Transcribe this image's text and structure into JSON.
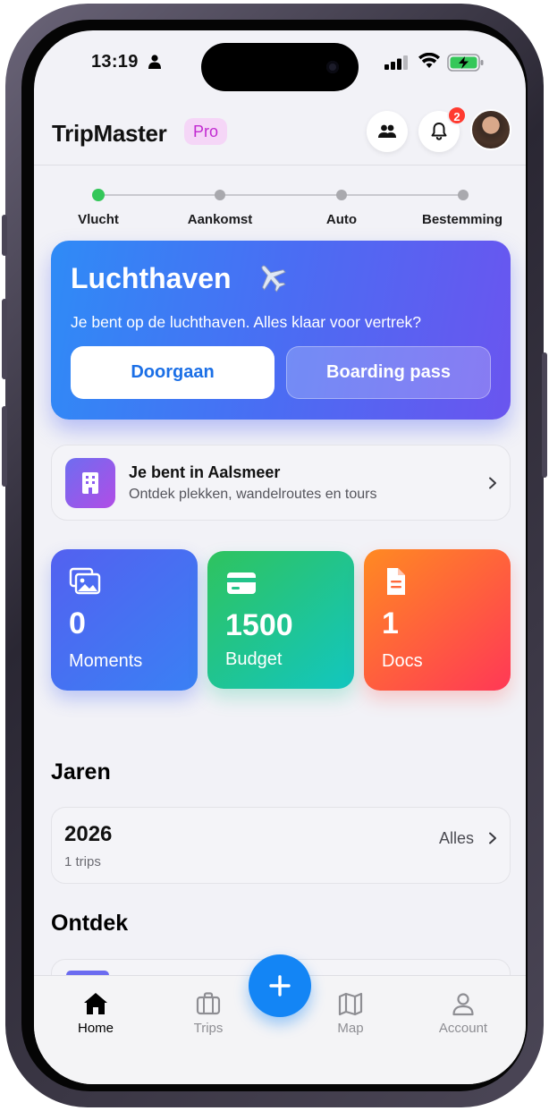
{
  "status_bar": {
    "time": "13:19"
  },
  "header": {
    "title": "TripMaster",
    "badge": "Pro",
    "notification_count": "2"
  },
  "stepper": {
    "steps": [
      {
        "label": "Vlucht",
        "active": true
      },
      {
        "label": "Aankomst",
        "active": false
      },
      {
        "label": "Auto",
        "active": false
      },
      {
        "label": "Bestemming",
        "active": false
      }
    ]
  },
  "hero": {
    "title": "Luchthaven",
    "icon": "airplane-icon",
    "subtitle": "Je bent op de luchthaven. Alles klaar voor vertrek?",
    "primary_label": "Doorgaan",
    "secondary_label": "Boarding pass"
  },
  "location": {
    "title": "Je bent in Aalsmeer",
    "subtitle": "Ontdek plekken, wandelroutes en tours"
  },
  "stats": [
    {
      "value": "0",
      "label": "Moments",
      "icon": "photos-icon"
    },
    {
      "value": "1500",
      "label": "Budget",
      "icon": "card-icon"
    },
    {
      "value": "1",
      "label": "Docs",
      "icon": "document-icon"
    }
  ],
  "years_section": {
    "title": "Jaren",
    "year": "2026",
    "count": "1 trips",
    "all_label": "Alles"
  },
  "discover_section": {
    "title": "Ontdek"
  },
  "tabbar": {
    "tabs": [
      {
        "label": "Home",
        "active": true
      },
      {
        "label": "Trips",
        "active": false
      },
      {
        "label": "Map",
        "active": false
      },
      {
        "label": "Account",
        "active": false
      }
    ]
  },
  "colors": {
    "accent": "#1385f5",
    "pro_badge_text": "#c12ad1",
    "active_step": "#34c759",
    "notification": "#ff3b30"
  }
}
